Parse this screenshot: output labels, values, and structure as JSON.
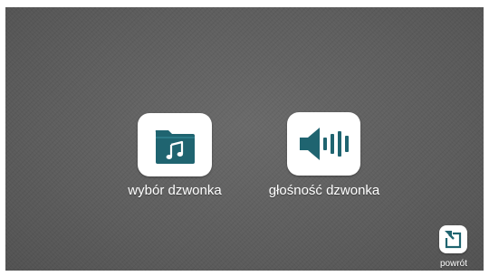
{
  "menu": {
    "ringtone_select": {
      "label": "wybór dzwonka",
      "icon": "music-folder-icon"
    },
    "ringtone_volume": {
      "label": "głośność dzwonka",
      "icon": "speaker-volume-icon"
    }
  },
  "back": {
    "label": "powrót",
    "icon": "return-arrow-icon"
  },
  "colors": {
    "background": "#5e5e5e",
    "tile": "#ffffff",
    "accent": "#1f6470",
    "text": "#ffffff"
  }
}
